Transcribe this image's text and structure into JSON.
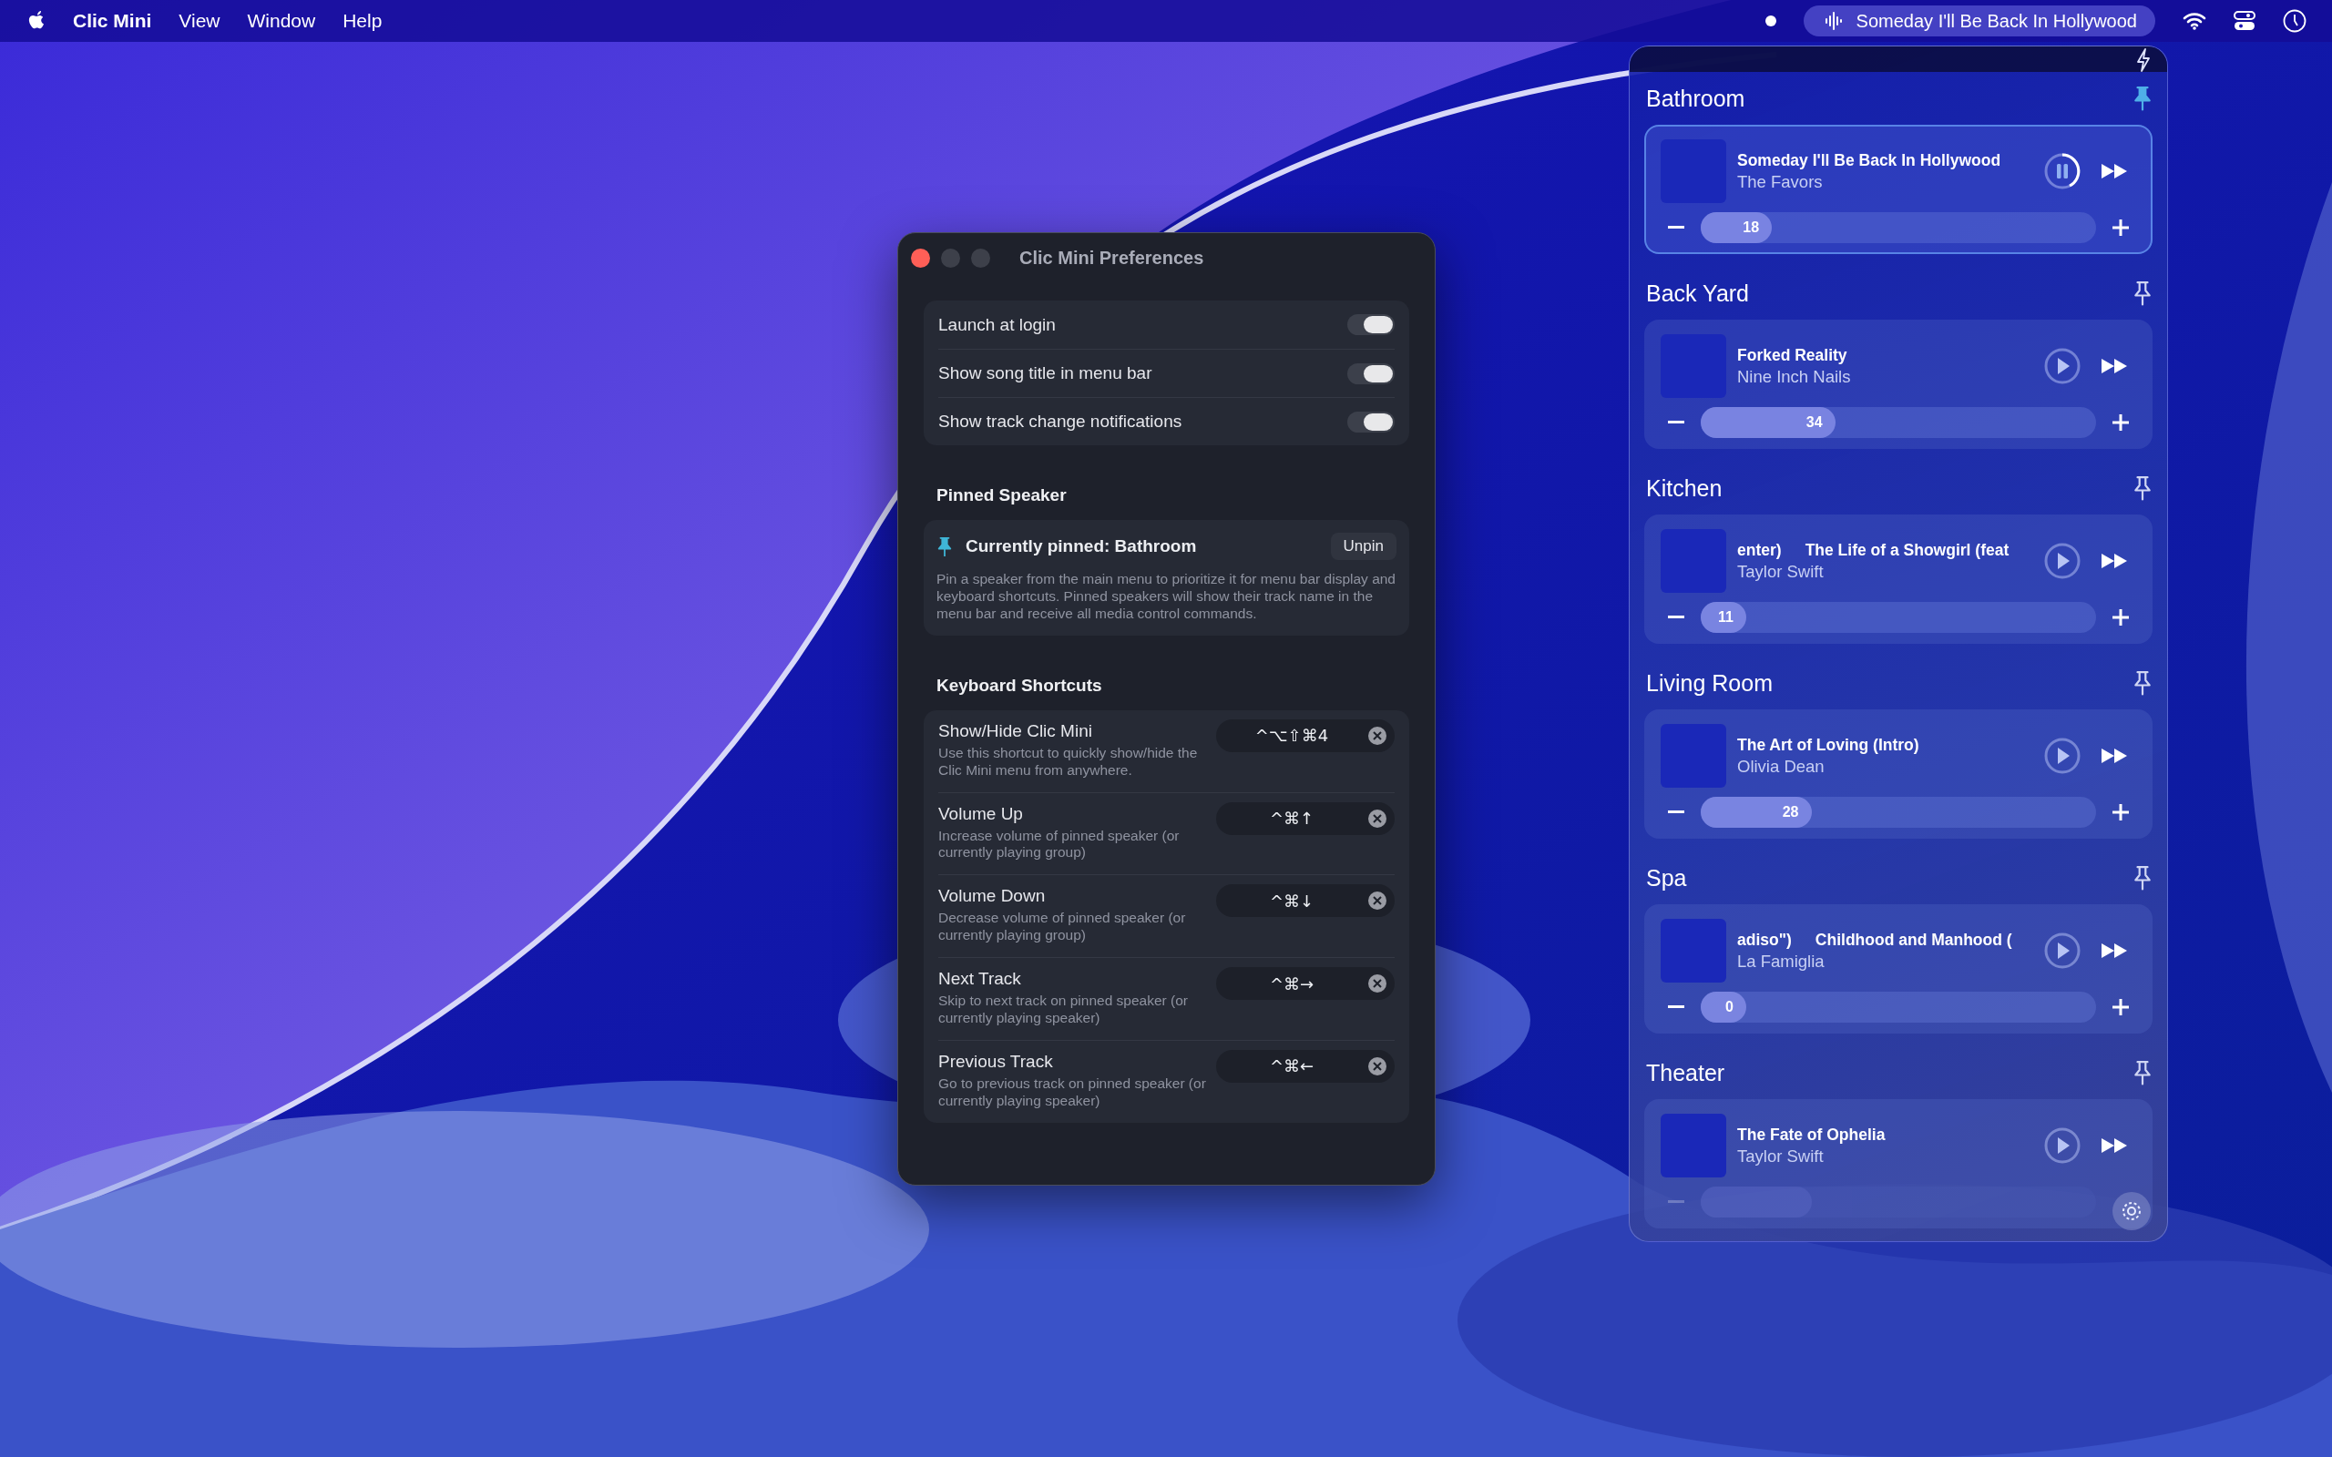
{
  "menu_bar": {
    "app_name": "Clic Mini",
    "menus": [
      "View",
      "Window",
      "Help"
    ],
    "now_playing": "Someday I'll Be Back In Hollywood"
  },
  "preferences": {
    "title": "Clic Mini Preferences",
    "toggles": [
      {
        "label": "Launch at login",
        "on": true
      },
      {
        "label": "Show song title in menu bar",
        "on": true
      },
      {
        "label": "Show track change notifications",
        "on": true
      }
    ],
    "pinned_section": {
      "heading": "Pinned Speaker",
      "current": "Currently pinned: Bathroom",
      "button": "Unpin",
      "description": "Pin a speaker from the main menu to prioritize it for menu bar display and keyboard shortcuts. Pinned speakers will show their track name in the menu bar and receive all media control commands."
    },
    "shortcuts_section": {
      "heading": "Keyboard Shortcuts",
      "items": [
        {
          "name": "Show/Hide Clic Mini",
          "description": "Use this shortcut to quickly show/hide the Clic Mini menu from anywhere.",
          "keys": "^⌥⇧⌘4"
        },
        {
          "name": "Volume Up",
          "description": "Increase volume of pinned speaker (or currently playing group)",
          "keys": "^⌘↑"
        },
        {
          "name": "Volume Down",
          "description": "Decrease volume of pinned speaker (or currently playing group)",
          "keys": "^⌘↓"
        },
        {
          "name": "Next Track",
          "description": "Skip to next track on pinned speaker (or currently playing speaker)",
          "keys": "^⌘→"
        },
        {
          "name": "Previous Track",
          "description": "Go to previous track on pinned speaker (or currently playing speaker)",
          "keys": "^⌘←"
        }
      ]
    }
  },
  "speakers": [
    {
      "name": "Bathroom",
      "pinned": true,
      "selected": true,
      "playing": true,
      "title_parts": [
        "Someday I'll Be Back In Hollywood"
      ],
      "artist": "The Favors",
      "volume": {
        "reading": "18",
        "level": 0.18,
        "dimmed": false
      }
    },
    {
      "name": "Back Yard",
      "pinned": false,
      "selected": false,
      "playing": false,
      "title_parts": [
        "Forked Reality"
      ],
      "artist": "Nine Inch Nails",
      "volume": {
        "reading": "34",
        "level": 0.34,
        "dimmed": false
      }
    },
    {
      "name": "Kitchen",
      "pinned": false,
      "selected": false,
      "playing": false,
      "title_parts": [
        "enter)",
        "The Life of a Showgirl (feat"
      ],
      "artist": "Taylor Swift",
      "volume": {
        "reading": "11",
        "level": 0.11,
        "dimmed": false
      }
    },
    {
      "name": "Living Room",
      "pinned": false,
      "selected": false,
      "playing": false,
      "title_parts": [
        "The Art of Loving (Intro)"
      ],
      "artist": "Olivia Dean",
      "volume": {
        "reading": "28",
        "level": 0.28,
        "dimmed": false
      }
    },
    {
      "name": "Spa",
      "pinned": false,
      "selected": false,
      "playing": false,
      "title_parts": [
        "adiso\")",
        "Childhood and Manhood ("
      ],
      "artist": "La Famiglia",
      "volume": {
        "reading": "0",
        "level": 0,
        "dimmed": false
      }
    },
    {
      "name": "Theater",
      "pinned": false,
      "selected": false,
      "playing": false,
      "title_parts": [
        "The Fate of Ophelia"
      ],
      "artist": "Taylor Swift",
      "volume": {
        "level": 0.28,
        "dimmed": true
      }
    }
  ]
}
